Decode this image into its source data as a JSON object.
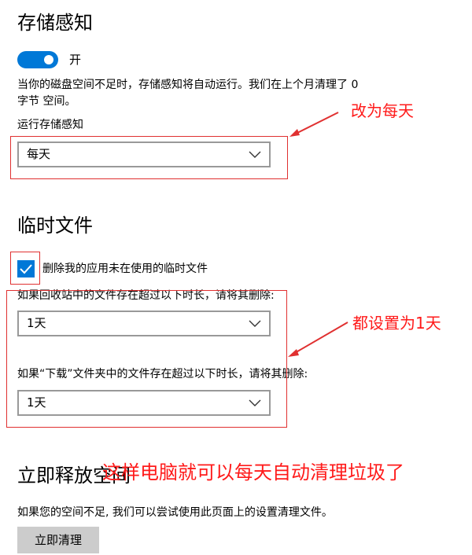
{
  "storage_sense": {
    "title": "存储感知",
    "toggle_label": "开",
    "description_line1": "当你的磁盘空间不足时，存储感知将自动运行。我们在上个月清理了 0",
    "description_line2": "字节 空间。",
    "run_label": "运行存储感知",
    "run_value": "每天"
  },
  "temp_files": {
    "title": "临时文件",
    "checkbox_label": "删除我的应用未在使用的临时文件",
    "recycle_label": "如果回收站中的文件存在超过以下时长，请将其删除:",
    "recycle_value": "1天",
    "downloads_label": "如果“下载”文件夹中的文件存在超过以下时长，请将其删除:",
    "downloads_value": "1天"
  },
  "free_space": {
    "title": "立即释放空间",
    "description": "如果您的空间不足, 我们可以尝试使用此页面上的设置清理文件。",
    "button_label": "立即清理"
  },
  "annotations": {
    "note1": "改为每天",
    "note2": "都设置为1天",
    "note3": "这样电脑就可以每天自动清理垃圾了"
  },
  "colors": {
    "accent": "#0078d7",
    "annotation": "#ff1a1a",
    "button_bg": "#cccccc",
    "dropdown_border": "#999999"
  }
}
